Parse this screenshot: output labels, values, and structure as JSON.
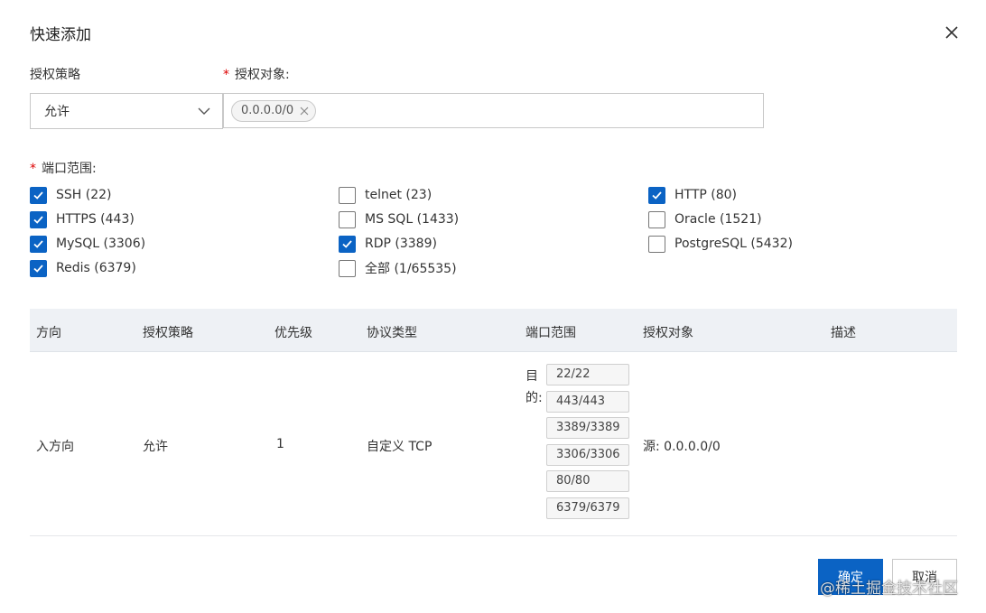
{
  "dialog": {
    "title": "快速添加",
    "close_icon": "close-icon"
  },
  "form": {
    "policy_label": "授权策略",
    "policy_value": "允许",
    "object_label": "授权对象:",
    "object_tags": [
      "0.0.0.0/0"
    ],
    "port_label": "端口范围:",
    "required_mark": "*"
  },
  "ports": [
    {
      "label": "SSH (22)",
      "checked": true
    },
    {
      "label": "telnet (23)",
      "checked": false
    },
    {
      "label": "HTTP (80)",
      "checked": true
    },
    {
      "label": "HTTPS (443)",
      "checked": true
    },
    {
      "label": "MS SQL (1433)",
      "checked": false
    },
    {
      "label": "Oracle (1521)",
      "checked": false
    },
    {
      "label": "MySQL (3306)",
      "checked": true
    },
    {
      "label": "RDP (3389)",
      "checked": true
    },
    {
      "label": "PostgreSQL (5432)",
      "checked": false
    },
    {
      "label": "Redis (6379)",
      "checked": true
    },
    {
      "label": "全部 (1/65535)",
      "checked": false
    }
  ],
  "table": {
    "headers": [
      "方向",
      "授权策略",
      "优先级",
      "协议类型",
      "端口范围",
      "授权对象",
      "描述"
    ],
    "row": {
      "direction": "入方向",
      "policy": "允许",
      "priority": "1",
      "protocol": "自定义 TCP",
      "dest_label": "目的:",
      "port_ranges": [
        "22/22",
        "443/443",
        "3389/3389",
        "3306/3306",
        "80/80",
        "6379/6379"
      ],
      "object": "源: 0.0.0.0/0",
      "description": ""
    }
  },
  "footer": {
    "ok": "确定",
    "cancel": "取消"
  },
  "watermark": "@稀土掘金技术社区",
  "colors": {
    "primary": "#0b63c4",
    "required": "#dd0000",
    "header_bg": "#eef1f5"
  }
}
